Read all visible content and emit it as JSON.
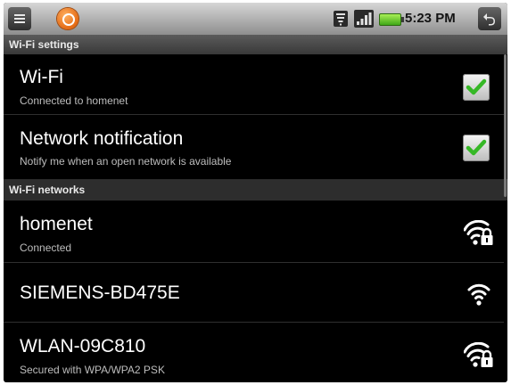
{
  "status_bar": {
    "time": "5:23 PM",
    "icons": [
      "menu-icon",
      "notification-icon",
      "wifi-status-icon",
      "signal-icon",
      "battery-icon",
      "back-icon"
    ]
  },
  "title": "Wi-Fi settings",
  "settings": {
    "wifi": {
      "title": "Wi-Fi",
      "summary": "Connected to homenet",
      "checked": true
    },
    "network_notification": {
      "title": "Network notification",
      "summary": "Notify me when an open network is available",
      "checked": true
    }
  },
  "networks_header": "Wi-Fi networks",
  "networks": [
    {
      "ssid": "homenet",
      "summary": "Connected",
      "secured": true,
      "icon": "wifi-locked-icon"
    },
    {
      "ssid": "SIEMENS-BD475E",
      "summary": "",
      "secured": false,
      "icon": "wifi-icon"
    },
    {
      "ssid": "WLAN-09C810",
      "summary": "Secured with WPA/WPA2 PSK",
      "secured": true,
      "icon": "wifi-locked-icon"
    }
  ],
  "colors": {
    "checkmark": "#36b826",
    "background": "#000000",
    "section_header": "#2d2d2d"
  }
}
